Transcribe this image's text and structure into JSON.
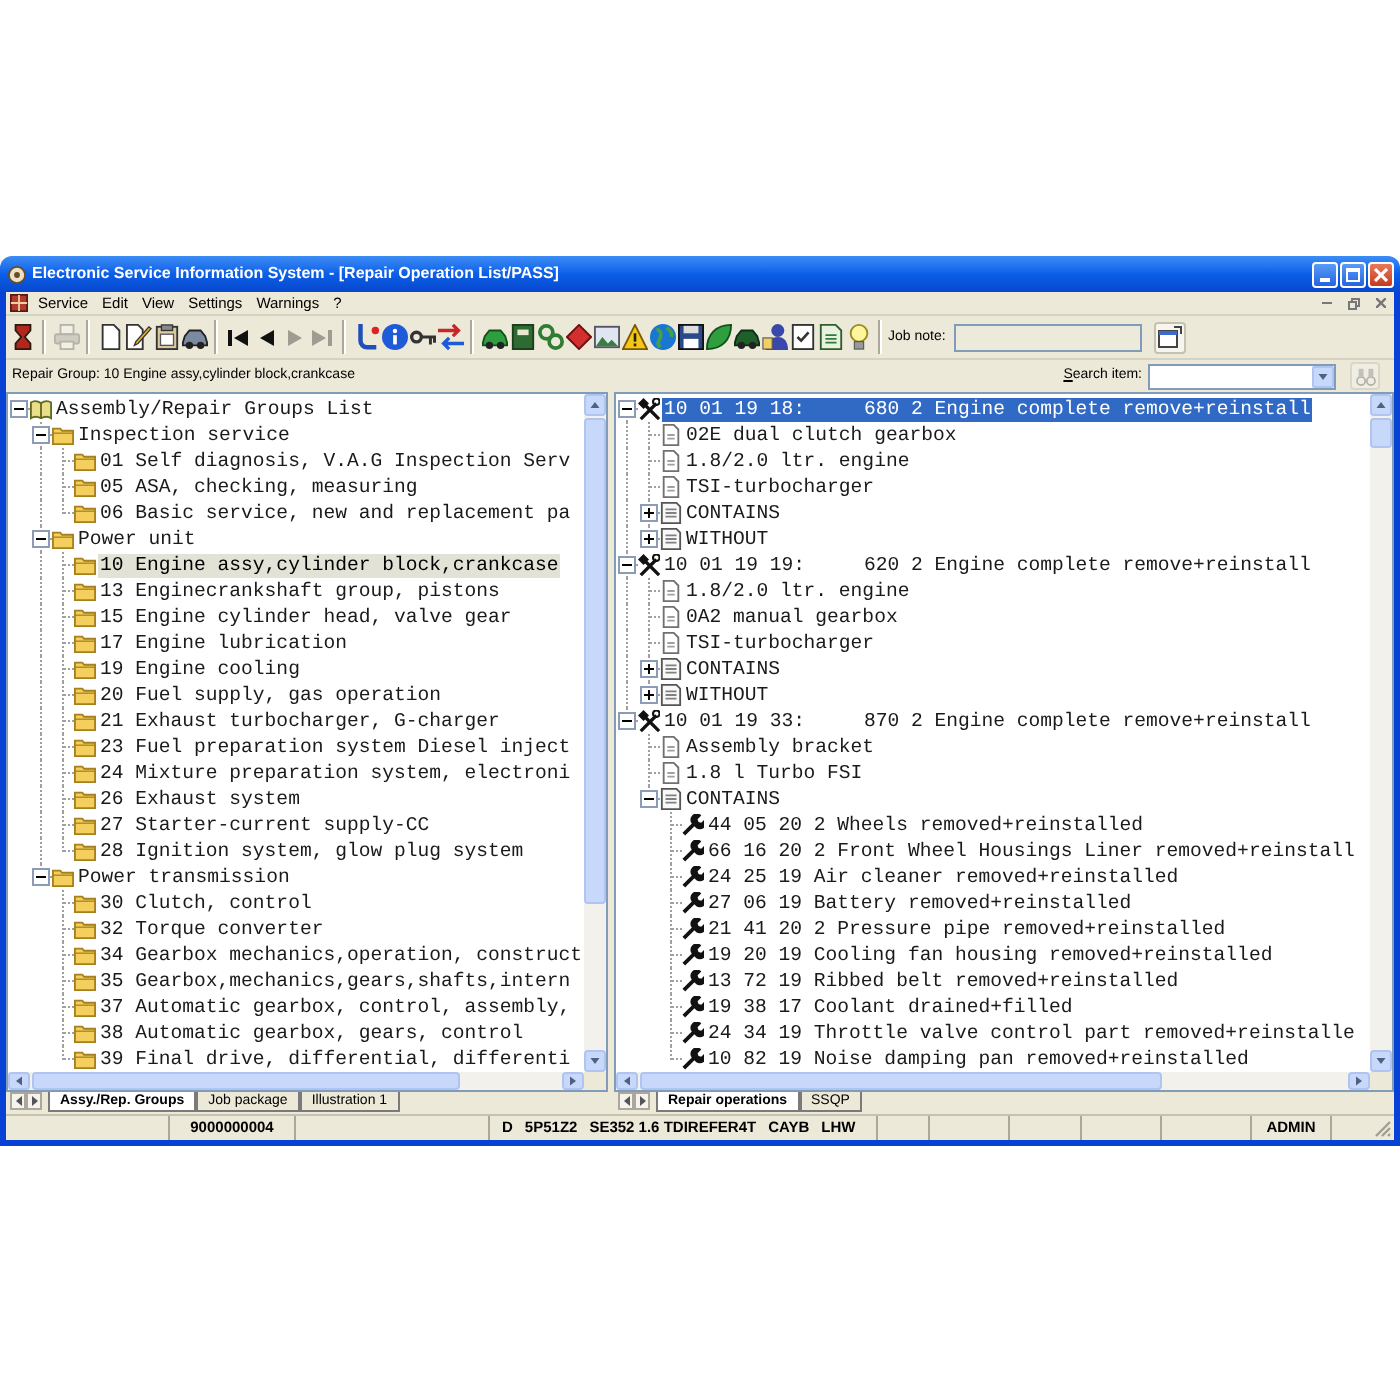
{
  "window": {
    "title": "Electronic Service Information System - [Repair Operation List/PASS]"
  },
  "menu": [
    {
      "label": "Service"
    },
    {
      "label": "Edit"
    },
    {
      "label": "View"
    },
    {
      "label": "Settings"
    },
    {
      "label": "Warnings"
    },
    {
      "label": "?"
    }
  ],
  "toolbar": {
    "groups": [
      {
        "buttons": [
          {
            "disabled": false
          }
        ]
      },
      {
        "buttons": [
          {
            "disabled": true
          }
        ]
      },
      {
        "buttons": [
          {
            "disabled": false
          },
          {
            "disabled": false
          },
          {
            "disabled": false
          },
          {
            "disabled": false
          }
        ]
      },
      {
        "buttons": [
          {
            "disabled": false
          },
          {
            "disabled": false
          },
          {
            "disabled": true
          },
          {
            "disabled": true
          }
        ]
      },
      {
        "buttons": [
          {
            "disabled": false
          },
          {
            "disabled": false
          },
          {
            "disabled": false
          },
          {
            "disabled": false
          }
        ]
      },
      {
        "buttons": [
          {
            "disabled": false
          },
          {
            "disabled": false
          },
          {
            "disabled": false
          },
          {
            "disabled": false
          },
          {
            "disabled": false
          },
          {
            "disabled": false
          },
          {
            "disabled": false
          },
          {
            "disabled": false
          },
          {
            "disabled": false
          },
          {
            "disabled": false
          },
          {
            "disabled": false
          },
          {
            "disabled": false
          },
          {
            "disabled": false
          },
          {
            "disabled": false
          }
        ]
      }
    ],
    "job_note": {
      "label": "Job note:",
      "disabled": true
    }
  },
  "info_bar": {
    "text": "Repair Group: 10 Engine assy,cylinder block,crankcase",
    "search": {
      "label": "Search item:"
    },
    "find_button": {
      "disabled": true
    }
  },
  "left_pane": {
    "tree": [
      {
        "label": "Assembly/Repair Groups List",
        "expanded": true,
        "selected": false,
        "children": [
          {
            "label": "Inspection service",
            "expanded": true,
            "selected": false,
            "children": [
              {
                "label": "01 Self diagnosis, V.A.G Inspection Serv",
                "selected": false
              },
              {
                "label": "05 ASA, checking, measuring",
                "selected": false
              },
              {
                "label": "06 Basic service, new and replacement pa",
                "selected": false
              }
            ]
          },
          {
            "label": "Power unit",
            "expanded": true,
            "selected": false,
            "children": [
              {
                "label": "10 Engine assy,cylinder block,crankcase",
                "selected": true
              },
              {
                "label": "13 Enginecrankshaft group, pistons",
                "selected": false
              },
              {
                "label": "15 Engine cylinder head, valve gear",
                "selected": false
              },
              {
                "label": "17 Engine lubrication",
                "selected": false
              },
              {
                "label": "19 Engine cooling",
                "selected": false
              },
              {
                "label": "20 Fuel supply, gas operation",
                "selected": false
              },
              {
                "label": "21 Exhaust turbocharger, G-charger",
                "selected": false
              },
              {
                "label": "23 Fuel preparation system Diesel inject",
                "selected": false
              },
              {
                "label": "24 Mixture preparation system, electroni",
                "selected": false
              },
              {
                "label": "26 Exhaust system",
                "selected": false
              },
              {
                "label": "27 Starter-current supply-CC",
                "selected": false
              },
              {
                "label": "28 Ignition system, glow plug system",
                "selected": false
              }
            ]
          },
          {
            "label": "Power transmission",
            "expanded": true,
            "selected": false,
            "children": [
              {
                "label": "30 Clutch, control",
                "selected": false
              },
              {
                "label": "32 Torque converter",
                "selected": false
              },
              {
                "label": "34 Gearbox mechanics,operation, construct",
                "selected": false
              },
              {
                "label": "35 Gearbox,mechanics,gears,shafts,intern",
                "selected": false
              },
              {
                "label": "37 Automatic gearbox, control, assembly,",
                "selected": false
              },
              {
                "label": "38 Automatic gearbox, gears, control",
                "selected": false
              },
              {
                "label": "39 Final drive, differential, differenti",
                "selected": false
              }
            ]
          }
        ]
      }
    ],
    "tabs": [
      {
        "label": "Assy./Rep. Groups",
        "selected": true
      },
      {
        "label": "Job package",
        "selected": false
      },
      {
        "label": "Illustration 1",
        "selected": false
      }
    ]
  },
  "right_pane": {
    "tree": [
      {
        "label": "10 01 19 18:     680 2 Engine complete remove+reinstall",
        "expanded": true,
        "selected": true,
        "children": [
          {
            "label": "02E dual clutch gearbox",
            "selected": false
          },
          {
            "label": "1.8/2.0 ltr. engine",
            "selected": false
          },
          {
            "label": "TSI-turbocharger",
            "selected": false
          },
          {
            "label": "CONTAINS",
            "expanded": false,
            "selected": false
          },
          {
            "label": "WITHOUT",
            "expanded": false,
            "selected": false
          }
        ]
      },
      {
        "label": "10 01 19 19:     620 2 Engine complete remove+reinstall",
        "expanded": true,
        "selected": false,
        "children": [
          {
            "label": "1.8/2.0 ltr. engine",
            "selected": false
          },
          {
            "label": "0A2 manual gearbox",
            "selected": false
          },
          {
            "label": "TSI-turbocharger",
            "selected": false
          },
          {
            "label": "CONTAINS",
            "expanded": false,
            "selected": false
          },
          {
            "label": "WITHOUT",
            "expanded": false,
            "selected": false
          }
        ]
      },
      {
        "label": "10 01 19 33:     870 2 Engine complete remove+reinstall",
        "expanded": true,
        "selected": false,
        "children": [
          {
            "label": "Assembly bracket",
            "selected": false
          },
          {
            "label": "1.8 l Turbo FSI",
            "selected": false
          },
          {
            "label": "CONTAINS",
            "expanded": true,
            "selected": false,
            "children": [
              {
                "label": "44 05 20 2 Wheels removed+reinstalled",
                "selected": false
              },
              {
                "label": "66 16 20 2 Front Wheel Housings Liner removed+reinstall",
                "selected": false
              },
              {
                "label": "24 25 19 Air cleaner removed+reinstalled",
                "selected": false
              },
              {
                "label": "27 06 19 Battery removed+reinstalled",
                "selected": false
              },
              {
                "label": "21 41 20 2 Pressure pipe removed+reinstalled",
                "selected": false
              },
              {
                "label": "19 20 19 Cooling fan housing removed+reinstalled",
                "selected": false
              },
              {
                "label": "13 72 19 Ribbed belt removed+reinstalled",
                "selected": false
              },
              {
                "label": "19 38 17 Coolant drained+filled",
                "selected": false
              },
              {
                "label": "24 34 19 Throttle valve control part removed+reinstalle",
                "selected": false
              },
              {
                "label": "10 82 19 Noise damping pan removed+reinstalled",
                "selected": false
              }
            ]
          }
        ]
      }
    ],
    "tabs": [
      {
        "label": "Repair operations",
        "selected": true
      },
      {
        "label": "SSQP",
        "selected": false
      }
    ]
  },
  "status_bar": {
    "panels": [
      {
        "items": [
          "9000000004"
        ]
      },
      {
        "items": [
          "D",
          "5P51Z2",
          "SE352 1.6 TDIREFER4T",
          "CAYB",
          "LHW"
        ]
      },
      {
        "items": [
          "ADMIN"
        ]
      }
    ]
  }
}
